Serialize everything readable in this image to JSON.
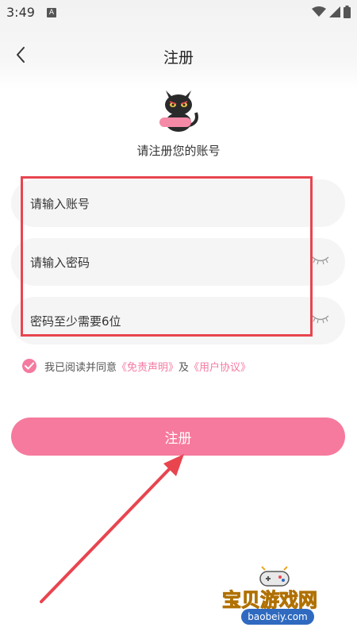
{
  "status_bar": {
    "time": "3:49",
    "badge": "A"
  },
  "nav": {
    "title": "注册"
  },
  "subtitle": "请注册您的账号",
  "form": {
    "account_placeholder": "请输入账号",
    "password_placeholder": "请输入密码",
    "confirm_placeholder": "密码至少需要6位"
  },
  "agreement": {
    "prefix": "我已阅读并同意",
    "disclaimer_link": "《免责声明》",
    "and": "及",
    "user_agreement_link": "《用户协议》",
    "checked": true
  },
  "register_button_label": "注册",
  "watermark": {
    "title": "宝贝游戏网",
    "url": "baobeiy.com"
  },
  "colors": {
    "accent_pink": "#f67a9d",
    "highlight_red": "#e8454f",
    "field_bg": "#f5f5f5"
  }
}
